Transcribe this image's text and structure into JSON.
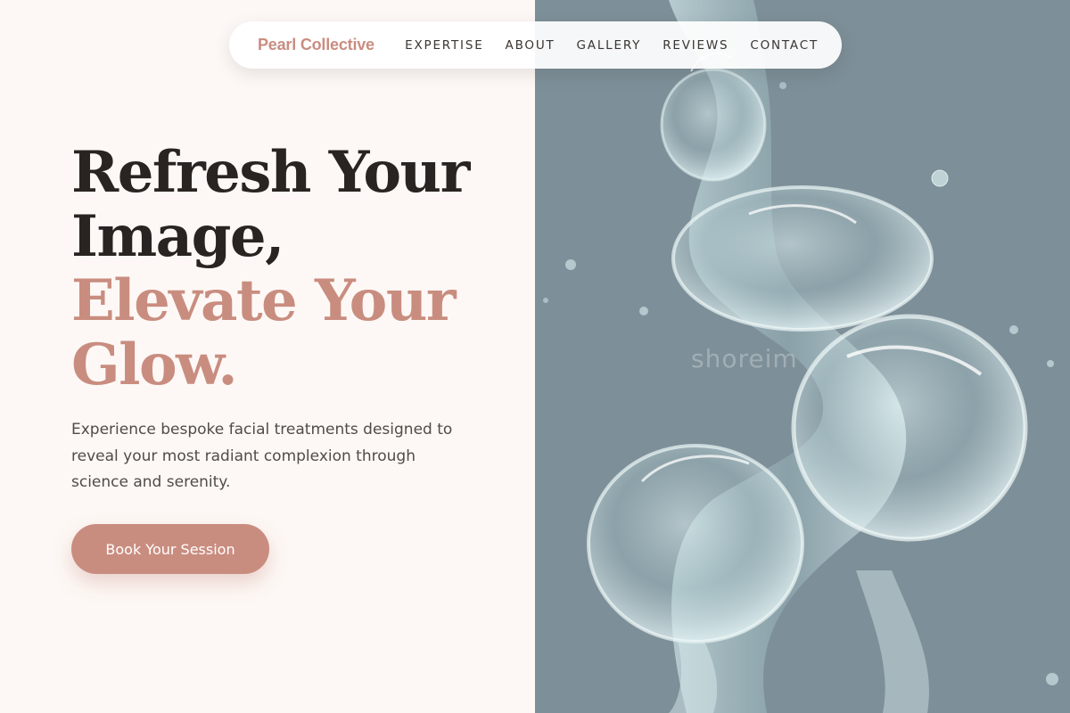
{
  "nav": {
    "brand": "Pearl Collective",
    "links": [
      {
        "label": "EXPERTISE"
      },
      {
        "label": "ABOUT"
      },
      {
        "label": "GALLERY"
      },
      {
        "label": "REVIEWS"
      },
      {
        "label": "CONTACT"
      }
    ]
  },
  "hero": {
    "headline_dark": [
      "Refresh Your",
      "Image,"
    ],
    "headline_accent": [
      "Elevate Your",
      "Glow."
    ],
    "subtext": "Experience bespoke facial treatments designed to reveal your most radiant complexion through science and serenity.",
    "cta_label": "Book Your Session"
  },
  "image": {
    "subject": "water-splash-image",
    "watermark": "shoreim"
  },
  "colors": {
    "accent": "#c98d80",
    "heading": "#292421",
    "background": "#fdf8f5",
    "image_background": "#7d8f98"
  }
}
